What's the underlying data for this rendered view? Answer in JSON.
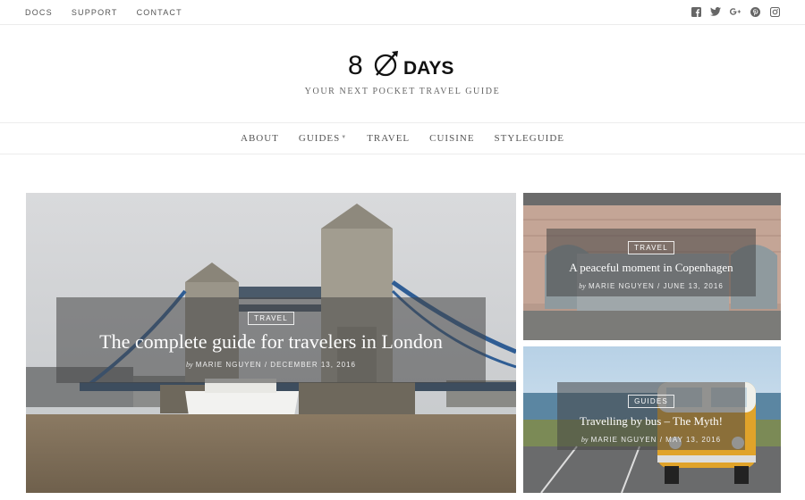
{
  "topbar": {
    "links": [
      "DOCS",
      "SUPPORT",
      "CONTACT"
    ],
    "social_icons": [
      "facebook-icon",
      "twitter-icon",
      "google-plus-icon",
      "pinterest-icon",
      "instagram-icon"
    ]
  },
  "header": {
    "logo_number": "8",
    "logo_word": "DAYS",
    "tagline": "YOUR NEXT POCKET TRAVEL GUIDE"
  },
  "nav": {
    "items": [
      "ABOUT",
      "GUIDES",
      "TRAVEL",
      "CUISINE",
      "STYLEGUIDE"
    ]
  },
  "posts": [
    {
      "category": "TRAVEL",
      "title": "The complete guide for travelers in London",
      "by": "by",
      "author": "MARIE NGUYEN",
      "separator": "/",
      "date": "DECEMBER 13, 2016"
    },
    {
      "category": "TRAVEL",
      "title": "A peaceful moment in Copenhagen",
      "by": "by",
      "author": "MARIE NGUYEN",
      "separator": "/",
      "date": "JUNE 13, 2016"
    },
    {
      "category": "GUIDES",
      "title": "Travelling by bus – The Myth!",
      "by": "by",
      "author": "MARIE NGUYEN",
      "separator": "/",
      "date": "MAY 13, 2016"
    }
  ]
}
